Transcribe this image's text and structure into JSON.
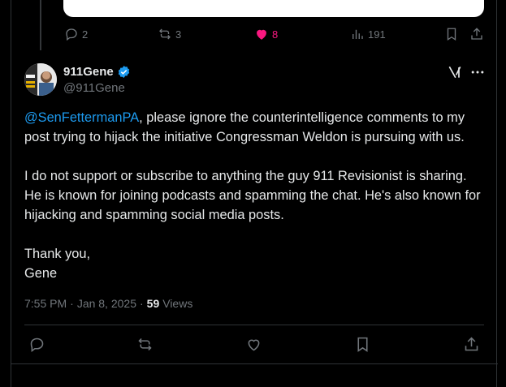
{
  "previous_post": {
    "replies": "2",
    "reposts": "3",
    "likes": "8",
    "views": "191"
  },
  "post": {
    "display_name": "911Gene",
    "handle": "@911Gene",
    "mention": "@SenFettermanPA",
    "text_after_mention": ", please ignore the counterintelligence comments to my post trying to hijack the initiative Congressman Weldon is pursuing with us.\n\nI do not support or subscribe to anything the guy 911 Revisionist is sharing. He is known for joining podcasts and spamming the chat. He's also known for hijacking and spamming social media posts.\n\nThank you,\nGene",
    "time": "7:55 PM",
    "date": "Jan 8, 2025",
    "views_count": "59",
    "views_label": "Views",
    "separator": "·"
  },
  "colors": {
    "accent": "#1d9bf0",
    "like": "#f91880",
    "muted": "#71767b",
    "text": "#e7e9ea",
    "background": "#000000"
  },
  "icons": {
    "reply": "reply-icon",
    "repost": "repost-icon",
    "like": "heart-icon",
    "views": "views-chart-icon",
    "bookmark": "bookmark-icon",
    "share": "share-icon",
    "verified": "verified-badge-icon",
    "grok": "grok-icon",
    "more": "more-icon"
  }
}
